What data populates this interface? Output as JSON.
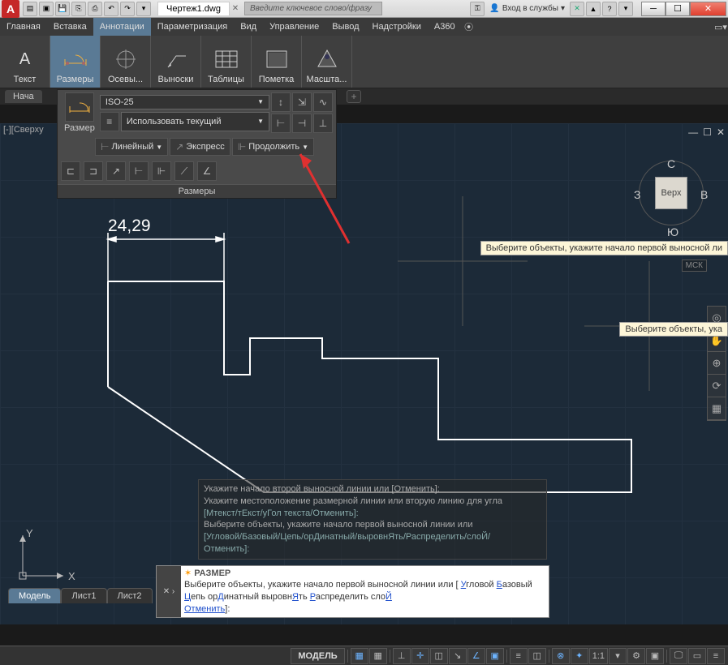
{
  "titlebar": {
    "app_letter": "A",
    "document_tab": "Чертеж1.dwg",
    "search_placeholder": "Введите ключевое слово/фразу",
    "signin": "Вход в службы"
  },
  "menu": {
    "items": [
      "Главная",
      "Вставка",
      "Аннотации",
      "Параметризация",
      "Вид",
      "Управление",
      "Вывод",
      "Надстройки",
      "A360"
    ],
    "active_index": 2
  },
  "ribbon": {
    "buttons": [
      "Текст",
      "Размеры",
      "Осевы...",
      "Выноски",
      "Таблицы",
      "Пометка",
      "Масшта..."
    ],
    "active_index": 1
  },
  "doctab_left": "Нача",
  "side_label": "[-][Сверху",
  "flyout": {
    "dim_label": "Размер",
    "style_combo": "ISO-25",
    "layer_combo": "Использовать текущий",
    "linear_btn": "Линейный",
    "express_btn": "Экспресс",
    "continue_btn": "Продолжить",
    "footer": "Размеры"
  },
  "viewcube": {
    "face": "Верх",
    "n": "C",
    "s": "Ю",
    "w": "З",
    "e": "В",
    "wcs": "МСК"
  },
  "dimension_value": "24,29",
  "tooltips": {
    "t1": "Выберите объекты, укажите начало первой выносной ли",
    "t2": "Выберите объекты, ука"
  },
  "cmd_history": {
    "l1": "Укажите начало второй выносной линии или [Отменить]:",
    "l2": "Укажите местоположение размерной линии или вторую линию для угла",
    "l3": "[Мтекст/тЕкст/уГол текста/Отменить]:",
    "l4": "Выберите объекты, укажите начало первой выносной линии или",
    "l5": "[Угловой/Базовый/Цепь/орДинатный/выровнЯть/Распределить/слоЙ/",
    "l6": "Отменить]:"
  },
  "cmd_line": {
    "title": "РАЗМЕР",
    "prompt_pre": "Выберите объекты, укажите начало первой выносной линии или [",
    "opts": [
      "Угловой",
      "Базовый",
      "Цепь",
      "орДинатный",
      "выровнЯть",
      "Распределить",
      "слоЙ"
    ],
    "cancel": "Отменить",
    "end": "]:"
  },
  "layout_tabs": {
    "items": [
      "Модель",
      "Лист1",
      "Лист2"
    ],
    "active_index": 0
  },
  "ucs": {
    "x": "X",
    "y": "Y"
  },
  "status": {
    "model": "МОДЕЛЬ",
    "scale": "1:1"
  }
}
